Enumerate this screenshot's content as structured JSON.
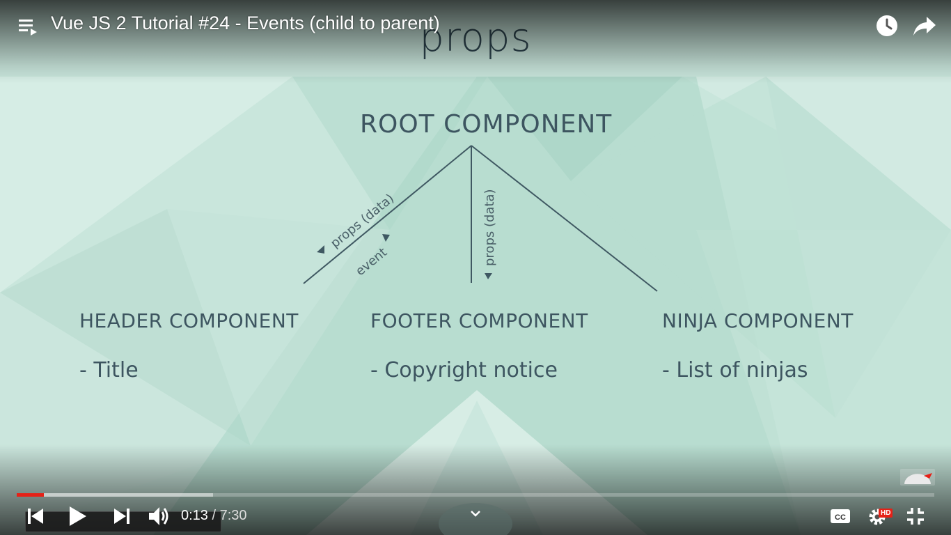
{
  "player": {
    "video_title": "Vue JS 2 Tutorial #24 - Events (child to parent)",
    "current_time": "0:13",
    "time_separator": " / ",
    "duration": "7:30",
    "progress_fraction": 0.0293,
    "buffered_fraction": 0.214,
    "hd_badge": "HD",
    "accent_color": "#e62117",
    "icons": {
      "playlist": "playlist-icon",
      "watch_later": "clock-icon",
      "share": "share-arrow-icon",
      "previous": "skip-previous-icon",
      "play": "play-icon",
      "next": "skip-next-icon",
      "volume": "volume-icon",
      "captions": "cc-icon",
      "settings": "gear-icon",
      "exit_fullscreen": "exit-fullscreen-icon",
      "expand": "chevron-down-icon"
    }
  },
  "slide": {
    "title": "props",
    "root": "ROOT COMPONENT",
    "edge_labels": {
      "left_props": "props (data)",
      "left_event": "event",
      "center_props": "props (data)"
    },
    "components": [
      {
        "name": "HEADER COMPONENT",
        "item": "- Title"
      },
      {
        "name": "FOOTER COMPONENT",
        "item": "- Copyright notice"
      },
      {
        "name": "NINJA COMPONENT",
        "item": "- List of ninjas"
      }
    ],
    "text_color": "#3d5560",
    "background_color": "#c6e4da"
  }
}
